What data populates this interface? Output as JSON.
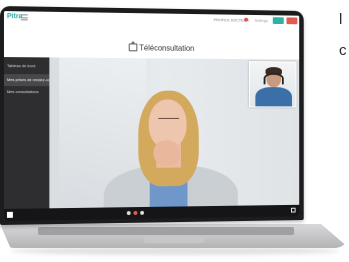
{
  "app": {
    "logo": "Pitra",
    "page_title": "Téléconsultation"
  },
  "topbar": {
    "user_label": "PROFILE DOCTEUR",
    "link_label": "Settings"
  },
  "sidebar": {
    "items": [
      {
        "label": "Tableau de bord"
      },
      {
        "label": "Mes prises de rendez-vous"
      },
      {
        "label": "Mes consultations"
      }
    ]
  },
  "edge_text": {
    "line1": "l",
    "line2": "c"
  },
  "colors": {
    "accent_teal": "#2ab3a6",
    "accent_red": "#e35b4f",
    "sidebar_bg": "#2e2e30"
  },
  "icons": [
    "menu-icon",
    "teleconsultation-icon",
    "windows-start-icon",
    "fullscreen-icon"
  ]
}
